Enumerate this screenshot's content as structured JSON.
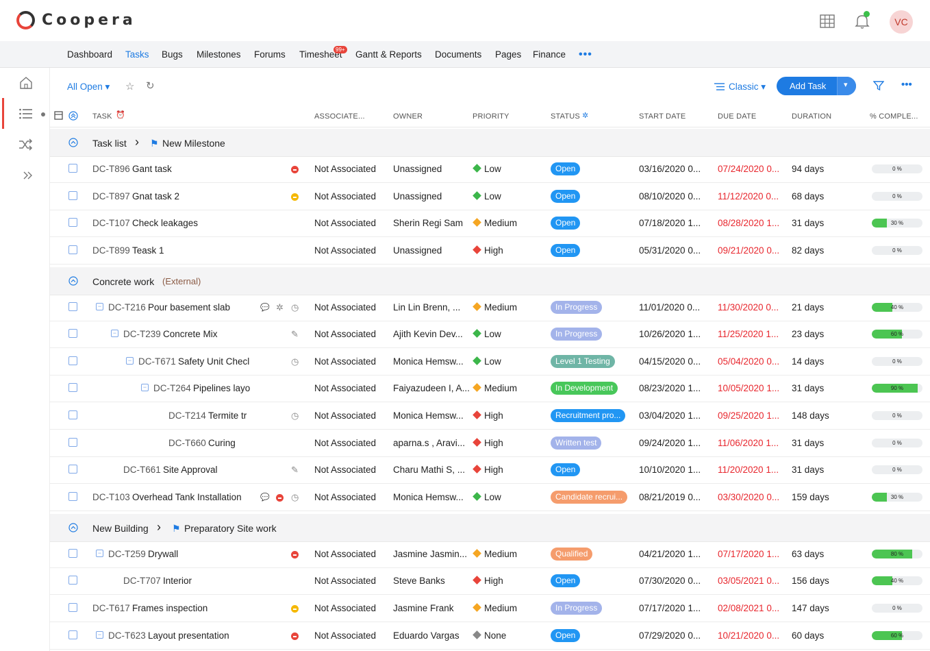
{
  "app": {
    "name": "Coopera",
    "avatar_initials": "VC"
  },
  "nav": {
    "items": [
      "Dashboard",
      "Tasks",
      "Bugs",
      "Milestones",
      "Forums",
      "Timesheet",
      "Gantt & Reports",
      "Documents",
      "Pages",
      "Finance"
    ],
    "active": "Tasks",
    "timesheet_badge": "99+",
    "more": "•••"
  },
  "toolbar": {
    "view": "All Open",
    "layout": "Classic",
    "add_task": "Add Task"
  },
  "columns": {
    "task": "TASK",
    "associated": "ASSOCIATE...",
    "owner": "OWNER",
    "priority": "PRIORITY",
    "status": "STATUS",
    "start": "START DATE",
    "due": "DUE DATE",
    "duration": "DURATION",
    "complete": "% COMPLE..."
  },
  "groups": [
    {
      "name": "Task list",
      "milestone": "New Milestone"
    },
    {
      "name": "Concrete work",
      "tag": "(External)"
    },
    {
      "name": "New Building",
      "milestone": "Preparatory Site work"
    }
  ],
  "rows": [
    {
      "code": "DC-T896",
      "name": "Gant task",
      "assoc": "Not Associated",
      "owner": "Unassigned",
      "priority": "Low",
      "status": "Open",
      "start": "03/16/2020 0...",
      "due": "07/24/2020 0...",
      "duration": "94 days",
      "pct": "0 %",
      "pct_value": 0
    },
    {
      "code": "DC-T897",
      "name": "Gnat task 2",
      "assoc": "Not Associated",
      "owner": "Unassigned",
      "priority": "Low",
      "status": "Open",
      "start": "08/10/2020 0...",
      "due": "11/12/2020 0...",
      "duration": "68 days",
      "pct": "0 %",
      "pct_value": 0
    },
    {
      "code": "DC-T107",
      "name": "Check leakages",
      "assoc": "Not Associated",
      "owner": "Sherin Regi Sam",
      "priority": "Medium",
      "status": "Open",
      "start": "07/18/2020 1...",
      "due": "08/28/2020 1...",
      "duration": "31 days",
      "pct": "30 %",
      "pct_value": 30
    },
    {
      "code": "DC-T899",
      "name": "Teask 1",
      "assoc": "Not Associated",
      "owner": "Unassigned",
      "priority": "High",
      "status": "Open",
      "start": "05/31/2020 0...",
      "due": "09/21/2020 0...",
      "duration": "82 days",
      "pct": "0 %",
      "pct_value": 0
    },
    {
      "code": "DC-T216",
      "name": "Pour basement slab",
      "assoc": "Not Associated",
      "owner": "Lin Lin Brenn, ...",
      "priority": "Medium",
      "status": "In Progress",
      "start": "11/01/2020 0...",
      "due": "11/30/2020 0...",
      "duration": "21 days",
      "pct": "40 %",
      "pct_value": 40
    },
    {
      "code": "DC-T239",
      "name": "Concrete Mix",
      "assoc": "Not Associated",
      "owner": "Ajith Kevin Dev...",
      "priority": "Low",
      "status": "In Progress",
      "start": "10/26/2020 1...",
      "due": "11/25/2020 1...",
      "duration": "23 days",
      "pct": "60 %",
      "pct_value": 60
    },
    {
      "code": "DC-T671",
      "name": "Safety Unit Checl",
      "assoc": "Not Associated",
      "owner": "Monica Hemsw...",
      "priority": "Low",
      "status": "Level 1 Testing",
      "start": "04/15/2020 0...",
      "due": "05/04/2020 0...",
      "duration": "14 days",
      "pct": "0 %",
      "pct_value": 0
    },
    {
      "code": "DC-T264",
      "name": "Pipelines layo",
      "assoc": "Not Associated",
      "owner": "Faiyazudeen I, A...",
      "priority": "Medium",
      "status": "In Development",
      "start": "08/23/2020 1...",
      "due": "10/05/2020 1...",
      "duration": "31 days",
      "pct": "90 %",
      "pct_value": 90
    },
    {
      "code": "DC-T214",
      "name": "Termite tr",
      "assoc": "Not Associated",
      "owner": "Monica Hemsw...",
      "priority": "High",
      "status": "Recruitment pro...",
      "start": "03/04/2020 1...",
      "due": "09/25/2020 1...",
      "duration": "148 days",
      "pct": "0 %",
      "pct_value": 0
    },
    {
      "code": "DC-T660",
      "name": "Curing",
      "assoc": "Not Associated",
      "owner": "aparna.s , Aravi...",
      "priority": "High",
      "status": "Written test",
      "start": "09/24/2020 1...",
      "due": "11/06/2020 1...",
      "duration": "31 days",
      "pct": "0 %",
      "pct_value": 0
    },
    {
      "code": "DC-T661",
      "name": "Site Approval",
      "assoc": "Not Associated",
      "owner": "Charu Mathi S, ...",
      "priority": "High",
      "status": "Open",
      "start": "10/10/2020 1...",
      "due": "11/20/2020 1...",
      "duration": "31 days",
      "pct": "0 %",
      "pct_value": 0
    },
    {
      "code": "DC-T103",
      "name": "Overhead Tank Installation",
      "assoc": "Not Associated",
      "owner": "Monica Hemsw...",
      "priority": "Low",
      "status": "Candidate recrui...",
      "start": "08/21/2019 0...",
      "due": "03/30/2020 0...",
      "duration": "159 days",
      "pct": "30 %",
      "pct_value": 30
    },
    {
      "code": "DC-T259",
      "name": "Drywall",
      "assoc": "Not Associated",
      "owner": "Jasmine Jasmin...",
      "priority": "Medium",
      "status": "Qualified",
      "start": "04/21/2020 1...",
      "due": "07/17/2020 1...",
      "duration": "63 days",
      "pct": "80 %",
      "pct_value": 80
    },
    {
      "code": "DC-T707",
      "name": "Interior",
      "assoc": "Not Associated",
      "owner": "Steve Banks",
      "priority": "High",
      "status": "Open",
      "start": "07/30/2020 0...",
      "due": "03/05/2021 0...",
      "duration": "156 days",
      "pct": "40 %",
      "pct_value": 40
    },
    {
      "code": "DC-T617",
      "name": "Frames inspection",
      "assoc": "Not Associated",
      "owner": "Jasmine Frank",
      "priority": "Medium",
      "status": "In Progress",
      "start": "07/17/2020 1...",
      "due": "02/08/2021 0...",
      "duration": "147 days",
      "pct": "0 %",
      "pct_value": 0
    },
    {
      "code": "DC-T623",
      "name": "Layout presentation",
      "assoc": "Not Associated",
      "owner": "Eduardo Vargas",
      "priority": "None",
      "status": "Open",
      "start": "07/29/2020 0...",
      "due": "10/21/2020 0...",
      "duration": "60 days",
      "pct": "60 %",
      "pct_value": 60
    }
  ],
  "colors": {
    "accent": "#1e7be2",
    "overdue": "#e8262d",
    "open": "#2196f3",
    "in_progress": "#a3b3ea",
    "level1": "#6fb5a6",
    "in_dev": "#48c75a",
    "recruit": "#2196f3",
    "written": "#a3b3ea",
    "candidate": "#f59c6c",
    "qualified": "#f59c6c",
    "low": "#3cb64a",
    "medium": "#f5a623",
    "high": "#e8443a",
    "none": "#888888"
  },
  "icons": {
    "apps": "grid-icon",
    "bell": "bell-icon",
    "home": "home-icon",
    "list": "list-icon",
    "shuffle": "shuffle-icon",
    "expand": "double-chevron-icon",
    "star": "star-icon",
    "refresh": "refresh-icon",
    "filter": "filter-icon"
  }
}
